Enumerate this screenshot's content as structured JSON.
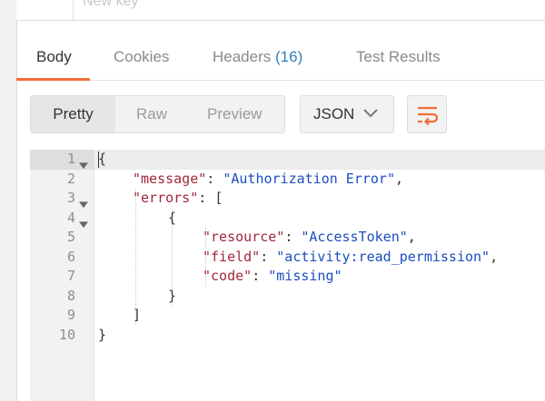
{
  "key_row": {
    "placeholder": "New key"
  },
  "tabs": [
    {
      "label": "Body",
      "active": true
    },
    {
      "label": "Cookies"
    },
    {
      "label": "Headers",
      "count": "(16)"
    },
    {
      "label": "Test Results"
    }
  ],
  "view_modes": [
    "Pretty",
    "Raw",
    "Preview"
  ],
  "format": {
    "selected": "JSON"
  },
  "icons": {
    "dropdown": "chevron-down-icon",
    "wrap": "wrap-lines-icon",
    "fold": "fold-arrow-icon"
  },
  "colors": {
    "accent": "#f26b3a",
    "json_key": "#a1283b",
    "json_string": "#1c4dbf",
    "count": "#2f7fc1"
  },
  "code": {
    "lines": [
      {
        "n": "1",
        "fold": true
      },
      {
        "n": "2"
      },
      {
        "n": "3",
        "fold": true
      },
      {
        "n": "4",
        "fold": true
      },
      {
        "n": "5"
      },
      {
        "n": "6"
      },
      {
        "n": "7"
      },
      {
        "n": "8"
      },
      {
        "n": "9"
      },
      {
        "n": "10"
      }
    ],
    "tokens": {
      "open_brace": "{",
      "message_key": "\"message\"",
      "message_value": "\"Authorization Error\"",
      "errors_key": "\"errors\"",
      "open_bracket": "[",
      "inner_open": "{",
      "resource_key": "\"resource\"",
      "resource_value": "\"AccessToken\"",
      "field_key": "\"field\"",
      "field_value": "\"activity:read_permission\"",
      "code_key": "\"code\"",
      "code_value": "\"missing\"",
      "inner_close": "}",
      "close_bracket": "]",
      "close_brace": "}"
    }
  }
}
